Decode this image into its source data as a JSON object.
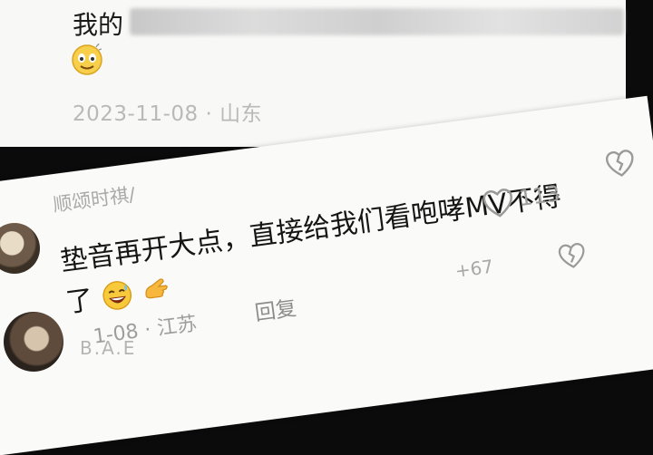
{
  "top_comment": {
    "author_prefix": "我的",
    "emoji_icon": "smiley-face-icon",
    "meta": "2023-11-08 · 山东"
  },
  "reply": {
    "username": "顺颂时祺/",
    "text_line1": "垫音再开大点，直接给我们看咆哮MV不得",
    "text_line2": "了",
    "emoji_icons": [
      "grinning-sweat-icon",
      "pointing-hand-icon"
    ],
    "meta": "1-08 · 江苏",
    "reply_label": "回复",
    "like_count": "113",
    "partial_count": "+67"
  },
  "next_comment": {
    "name_partial": "B.A.E"
  },
  "colors": {
    "card": "#fafaf8",
    "text": "#151515",
    "muted": "#a9a9a9"
  }
}
